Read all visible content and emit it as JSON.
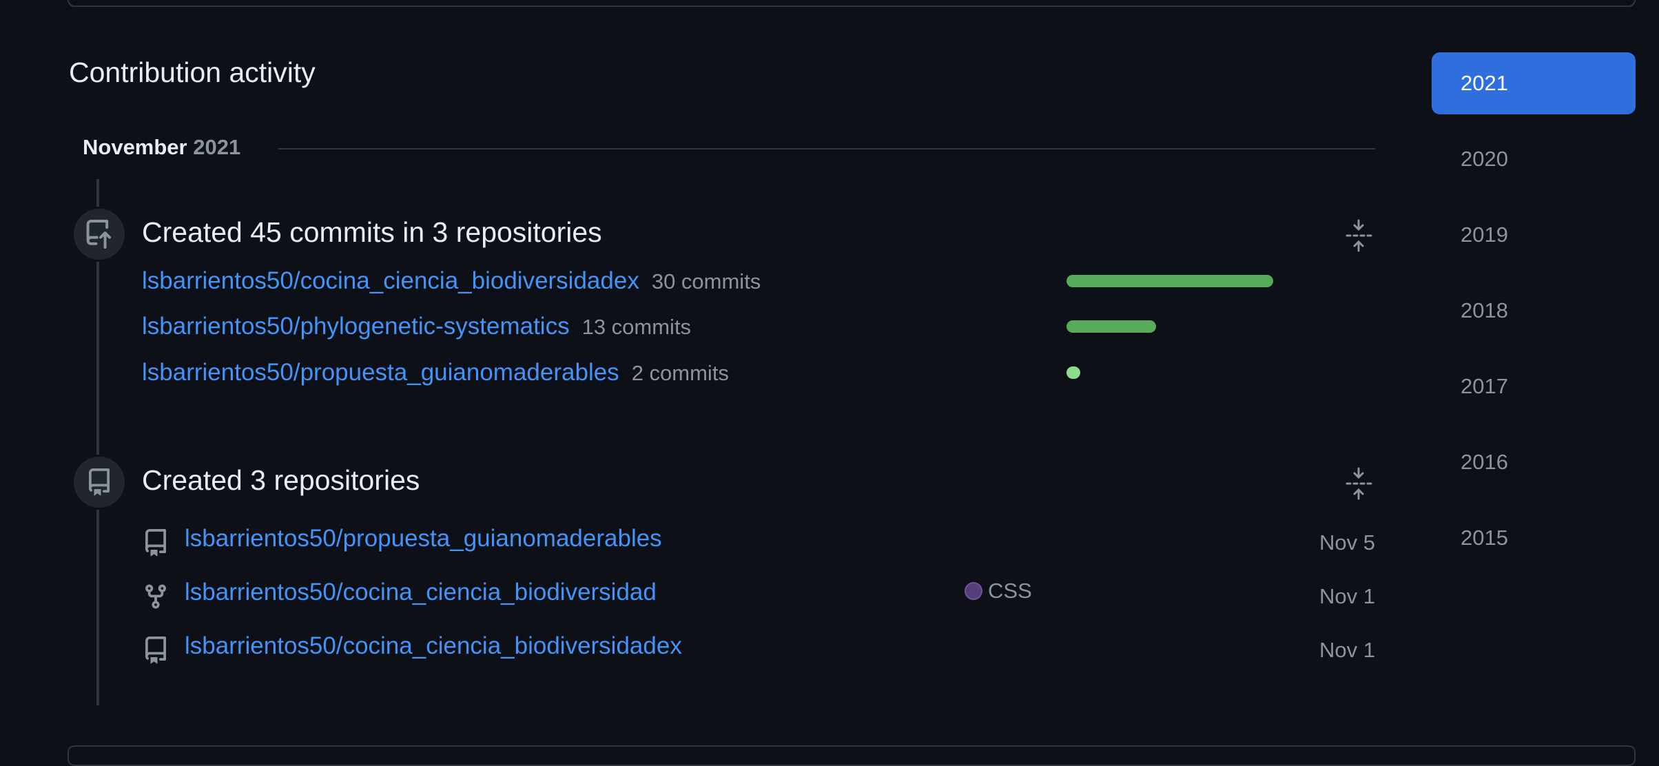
{
  "section": {
    "title": "Contribution activity"
  },
  "month": {
    "name": "November",
    "year": "2021"
  },
  "commits_event": {
    "heading": "Created 45 commits in 3 repositories",
    "repos": [
      {
        "name": "lsbarrientos50/cocina_ciencia_biodiversidadex",
        "count_label": "30 commits",
        "commits": 30
      },
      {
        "name": "lsbarrientos50/phylogenetic-systematics",
        "count_label": "13 commits",
        "commits": 13
      },
      {
        "name": "lsbarrientos50/propuesta_guianomaderables",
        "count_label": "2 commits",
        "commits": 2
      }
    ],
    "max_commits": 30
  },
  "repos_event": {
    "heading": "Created 3 repositories",
    "repos": [
      {
        "name": "lsbarrientos50/propuesta_guianomaderables",
        "date": "Nov 5",
        "icon": "repo-icon"
      },
      {
        "name": "lsbarrientos50/cocina_ciencia_biodiversidad",
        "date": "Nov 1",
        "icon": "fork-icon",
        "language": "CSS",
        "language_color": "#563d7c"
      },
      {
        "name": "lsbarrientos50/cocina_ciencia_biodiversidadex",
        "date": "Nov 1",
        "icon": "repo-icon"
      }
    ]
  },
  "years": {
    "items": [
      "2021",
      "2020",
      "2019",
      "2018",
      "2017",
      "2016",
      "2015"
    ],
    "selected": "2021"
  },
  "colors": {
    "background": "#0d1117",
    "link": "#4493f8",
    "bar_dark": "#57ab5a",
    "bar_light": "#8ddb8c",
    "accent": "#2f6fdd",
    "muted": "#8b949e"
  }
}
